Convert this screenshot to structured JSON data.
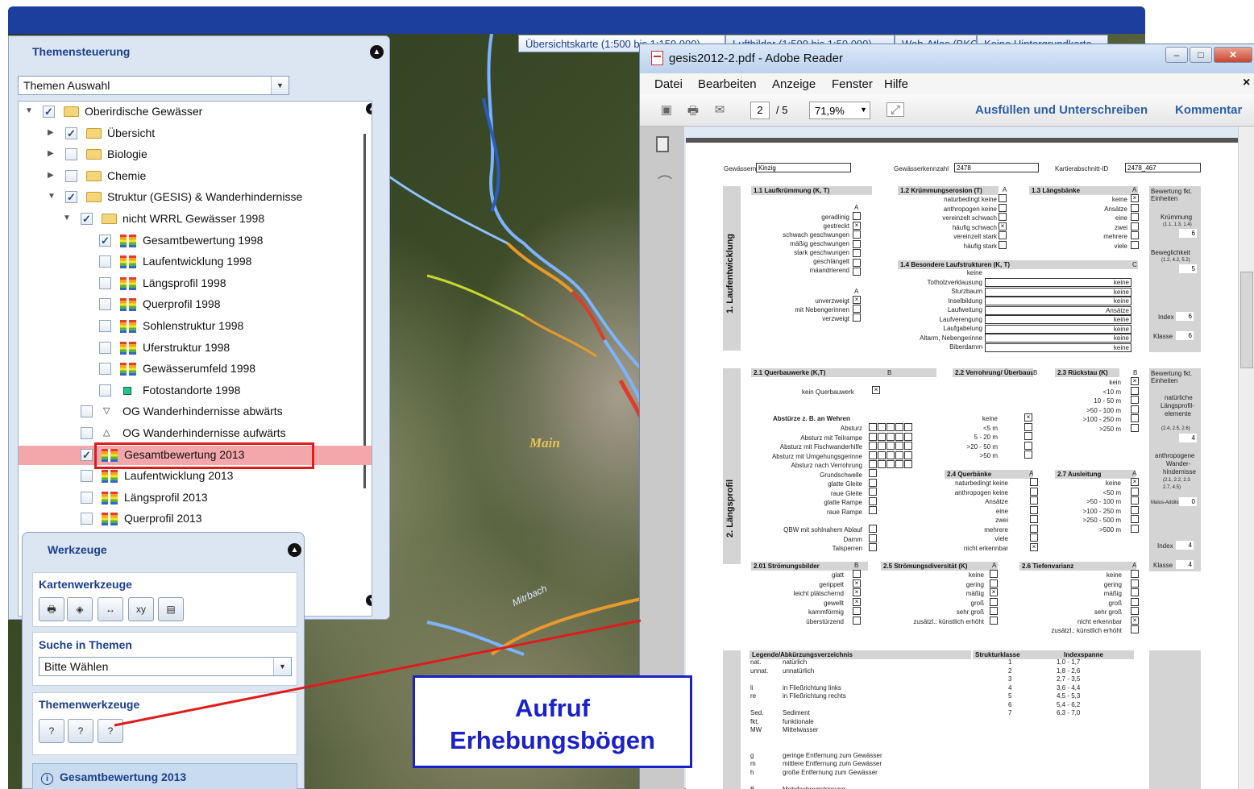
{
  "map_tabs": [
    "Übersichtskarte (1:500 bis 1:150.000)",
    "Luftbilder (1:500 bis 1:50.000)",
    "Web-Atlas (BKG)",
    "Keine Hintergrundkarte"
  ],
  "map_labels": {
    "main": "Main",
    "mitrbach": "Mitrbach"
  },
  "themen": {
    "title": "Themensteuerung",
    "auswahl": "Themen Auswahl",
    "tree": [
      {
        "label": "Oberirdische Gewässer",
        "checked": true,
        "type": "folder",
        "indent": 0,
        "arrow": "▼"
      },
      {
        "label": "Übersicht",
        "checked": true,
        "type": "folder",
        "indent": 1,
        "arrow": "▶"
      },
      {
        "label": "Biologie",
        "checked": false,
        "type": "folder",
        "indent": 1,
        "arrow": "▶"
      },
      {
        "label": "Chemie",
        "checked": false,
        "type": "folder",
        "indent": 1,
        "arrow": "▶"
      },
      {
        "label": "Struktur (GESIS) & Wanderhindernisse",
        "checked": true,
        "type": "folder",
        "indent": 1,
        "arrow": "▼"
      },
      {
        "label": "nicht WRRL Gewässer 1998",
        "checked": true,
        "type": "folder",
        "indent": 2,
        "arrow": "▼"
      },
      {
        "label": "Gesamtbewertung 1998",
        "checked": true,
        "type": "layer",
        "indent": 3
      },
      {
        "label": "Laufentwicklung 1998",
        "checked": false,
        "type": "layer",
        "indent": 3
      },
      {
        "label": "Längsprofil 1998",
        "checked": false,
        "type": "layer",
        "indent": 3
      },
      {
        "label": "Querprofil 1998",
        "checked": false,
        "type": "layer",
        "indent": 3
      },
      {
        "label": "Sohlenstruktur 1998",
        "checked": false,
        "type": "layer",
        "indent": 3
      },
      {
        "label": "Uferstruktur 1998",
        "checked": false,
        "type": "layer",
        "indent": 3
      },
      {
        "label": "Gewässerumfeld 1998",
        "checked": false,
        "type": "layer",
        "indent": 3
      },
      {
        "label": "Fotostandorte 1998",
        "checked": false,
        "type": "point",
        "indent": 3
      },
      {
        "label": "OG Wanderhindernisse abwärts",
        "checked": false,
        "type": "down",
        "indent": 2
      },
      {
        "label": "OG Wanderhindernisse aufwärts",
        "checked": false,
        "type": "up",
        "indent": 2
      },
      {
        "label": "Gesamtbewertung 2013",
        "checked": true,
        "type": "layer",
        "indent": 2,
        "selected": true
      },
      {
        "label": "Laufentwicklung 2013",
        "checked": false,
        "type": "layer",
        "indent": 2
      },
      {
        "label": "Längsprofil 2013",
        "checked": false,
        "type": "layer",
        "indent": 2
      },
      {
        "label": "Querprofil 2013",
        "checked": false,
        "type": "layer",
        "indent": 2
      }
    ]
  },
  "werkzeuge": {
    "title": "Werkzeuge",
    "karten_title": "Kartenwerkzeuge",
    "karten_tools": [
      "print-icon",
      "layers-icon",
      "measure-icon",
      "coordinates-icon",
      "export-icon"
    ],
    "karten_tool_glyphs": [
      "🖶",
      "◈",
      "↔",
      "xy",
      "▤"
    ],
    "suche_title": "Suche in Themen",
    "suche_value": "Bitte Wählen",
    "themen_title": "Themenwerkzeuge",
    "themen_tool_glyphs": [
      "?",
      "?",
      "?"
    ],
    "info": "Gesamtbewertung 2013",
    "info_icon": "i"
  },
  "reader": {
    "title": "gesis2012-2.pdf - Adobe Reader",
    "menu": [
      "Datei",
      "Bearbeiten",
      "Anzeige",
      "Fenster",
      "Hilfe"
    ],
    "close_x": "×",
    "page": "2",
    "page_total": "/ 5",
    "zoom": "71,9%",
    "fill_sign": "Ausfüllen und Unterschreiben",
    "comment": "Kommentar",
    "form": {
      "name_label": "Gewässername",
      "name_value": "Kinzig",
      "kz_label": "Gewässerkennzahl",
      "kz_value": "2478",
      "ka_label": "Kartierabschnitt-ID",
      "ka_value": "2478_467",
      "sec1": "1. Laufentwicklung",
      "sec2": "2. Längsprofil",
      "h11": "1.1 Laufkrümmung (K, T)",
      "h12": "1.2 Krümmungserosion (T)",
      "h13": "1.3 Längsbänke",
      "h14": "1.4 Besondere Laufstrukturen (K, T)",
      "col_a": "A",
      "col_b": "B",
      "col_c": "C",
      "l11": [
        "geradlinig",
        "gestreckt",
        "schwach geschwungen",
        "mäßig geschwungen",
        "stark geschwungen",
        "geschlängelt",
        "mäandrierend"
      ],
      "l11b": [
        "unverzweigt",
        "mit Nebengerinnen",
        "verzweigt"
      ],
      "l12": [
        "naturbedingt keine",
        "anthropogen keine",
        "vereinzelt schwach",
        "häufig schwach",
        "vereinzelt stark",
        "häufig stark"
      ],
      "l13": [
        "keine",
        "Ansätze",
        "eine",
        "zwei",
        "mehrere",
        "viele"
      ],
      "l14": [
        "keine",
        "Totholzverklausung",
        "Sturzbaum",
        "Inselbildung",
        "Laufweitung",
        "Laufverengung",
        "Laufgabelung",
        "Altarm, Nebengerinne",
        "Biberdamm"
      ],
      "v14": [
        "keine",
        "keine",
        "keine",
        "Ansätze",
        "keine",
        "keine",
        "keine",
        "keine"
      ],
      "bew": "Bewertung fkt. Einheiten",
      "kruemmung": "Krümmung",
      "kr_codes": "(1.1, 1.3, 1.4)",
      "kr_val": "6",
      "beweg": "Beweglichkeit",
      "bw_codes": "(1.2, 4.2, 5.2)",
      "bw_val": "5",
      "index": "Index",
      "index1": "6",
      "klasse": "Klasse",
      "klasse1": "6",
      "h21": "2.1 Querbauwerke (K,T)",
      "h22": "2.2 Verrohrung/ Überbauung (K,T)",
      "h23": "2.3 Rückstau (K)",
      "h24": "2.4 Querbänke",
      "h27": "2.7 Ausleitung",
      "h201": "2.01 Strömungsbilder",
      "h25": "2.5 Strömungsdiversität (K)",
      "h26": "2.6 Tiefenvarianz",
      "kein_qb": "kein Querbauwerk",
      "abstuerze": "Abstürze z. B. an Wehren",
      "l21": [
        "Absturz",
        "Absturz mit Teilrampe",
        "Absturz mit Fischwanderhilfe",
        "Absturz mit Umgehungsgerinne",
        "Absturz nach Verrohrung",
        "Grundschwelle",
        "glatte Gleite",
        "raue Gleite",
        "glatte Rampe",
        "raue Rampe"
      ],
      "l21b": [
        "QBW mit sohlnahem Ablauf",
        "Damm",
        "Talsperren"
      ],
      "l22": [
        "keine",
        "<5 m",
        "5 - 20 m",
        ">20 - 50 m",
        ">50 m"
      ],
      "l23": [
        "kein",
        "<10 m",
        "10 - 50 m",
        ">50 - 100 m",
        ">100 - 250 m",
        ">250 m"
      ],
      "l24": [
        "naturbedingt keine",
        "anthropogen keine",
        "Ansätze",
        "eine",
        "zwei",
        "mehrere",
        "viele",
        "nicht erkennbar"
      ],
      "l27": [
        "keine",
        "<50 m",
        ">50 - 100 m",
        ">100 - 250 m",
        ">250 - 500 m",
        ">500 m"
      ],
      "l201": [
        "glatt",
        "gerippelt",
        "leicht plätschernd",
        "gewellt",
        "kammförmig",
        "überstürzend"
      ],
      "l25": [
        "keine",
        "gering",
        "mäßig",
        "groß",
        "sehr groß",
        "zusätzl.: künstlich erhöht"
      ],
      "l26": [
        "keine",
        "gering",
        "mäßig",
        "groß",
        "sehr groß",
        "nicht erkennbar",
        "zusätzl.: künstlich erhöht"
      ],
      "bew2": [
        "natürliche",
        "Längsprofil-",
        "elemente"
      ],
      "codes2a": "(2.4, 2.5, 2.6)",
      "val2a": "4",
      "anth": [
        "anthropogene",
        "Wander-",
        "hindernisse"
      ],
      "codes2b": "(2.1, 2.2, 2.3 2.7, 4.5)",
      "malus": "Malus-Addition",
      "malus_val": "0",
      "index2": "4",
      "klasse2": "4",
      "leg_title": "Legende/Abkürzungsverzeichnis",
      "leg_sk": "Strukturklasse",
      "leg_is": "Indexspanne",
      "legend": [
        [
          "nat.",
          "natürlich"
        ],
        [
          "unnat.",
          "unnatürlich"
        ],
        [
          "",
          ""
        ],
        [
          "li",
          "in Fließrichtung links"
        ],
        [
          "re",
          "in Fließrichtung rechts"
        ],
        [
          "",
          ""
        ],
        [
          "Sed.",
          "Sediment"
        ],
        [
          "fkt.",
          "funktionale"
        ],
        [
          "MW",
          "Mittelwasser"
        ],
        [
          "",
          ""
        ],
        [
          "",
          ""
        ],
        [
          "g",
          "geringe Entfernung zum Gewässer"
        ],
        [
          "m",
          "mittlere Entfernung zum Gewässer"
        ],
        [
          "h",
          "große Entfernung zum Gewässer"
        ],
        [
          "",
          ""
        ],
        [
          "B",
          "Mehrfachregistrierung"
        ]
      ],
      "klassen": [
        "1",
        "2",
        "3",
        "4",
        "5",
        "6",
        "7"
      ],
      "spannen": [
        "1,0 - 1,7",
        "1,8 - 2,6",
        "2,7 - 3,5",
        "3,6 - 4,4",
        "4,5 - 5,3",
        "5,4 - 6,2",
        "6,3 - 7,0"
      ]
    }
  },
  "callout": {
    "line1": "Aufruf",
    "line2": "Erhebungsbögen"
  }
}
